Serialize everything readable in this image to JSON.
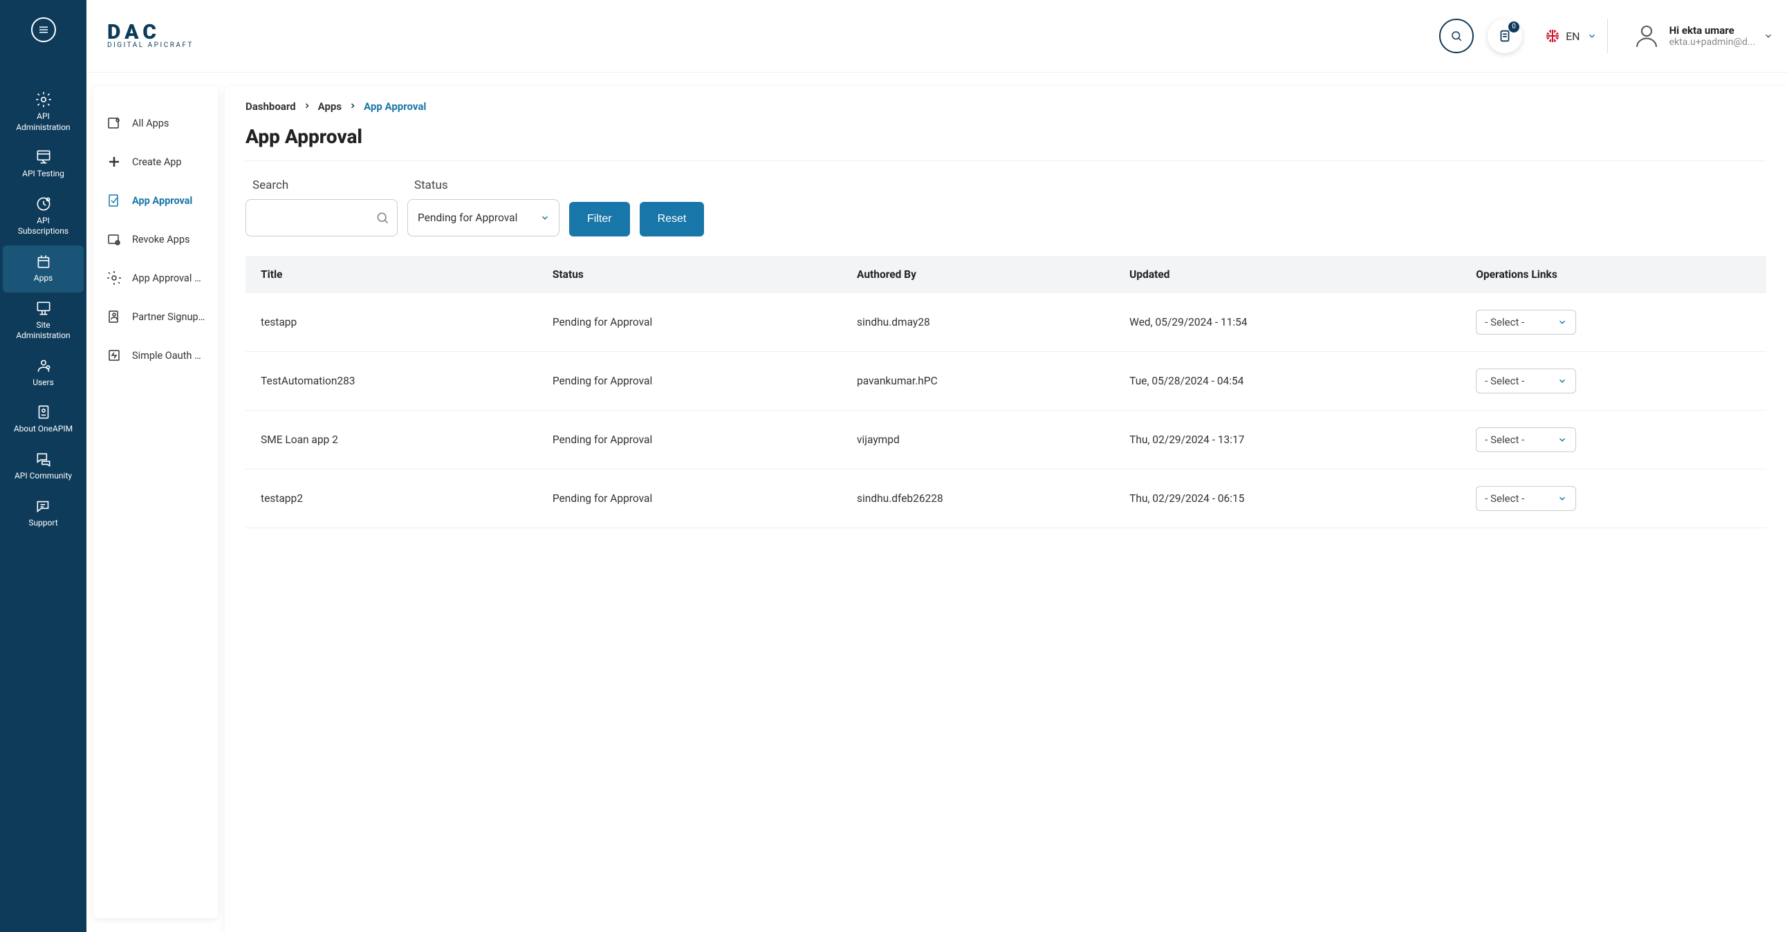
{
  "brand": {
    "name": "DAC",
    "tagline": "DIGITAL APICRAFT"
  },
  "header": {
    "badge_count": "0",
    "lang": "EN",
    "greeting": "Hi ekta umare",
    "email": "ekta.u+padmin@d..."
  },
  "nav_rail": [
    {
      "id": "api-admin",
      "label": "API\nAdministration"
    },
    {
      "id": "api-testing",
      "label": "API Testing"
    },
    {
      "id": "api-subs",
      "label": "API\nSubscriptions"
    },
    {
      "id": "apps",
      "label": "Apps",
      "active": true
    },
    {
      "id": "site-admin",
      "label": "Site\nAdministration"
    },
    {
      "id": "users",
      "label": "Users"
    },
    {
      "id": "about",
      "label": "About OneAPIM"
    },
    {
      "id": "community",
      "label": "API Community"
    },
    {
      "id": "support",
      "label": "Support"
    }
  ],
  "sub_sidebar": [
    {
      "label": "All Apps"
    },
    {
      "label": "Create App"
    },
    {
      "label": "App Approval",
      "active": true
    },
    {
      "label": "Revoke Apps"
    },
    {
      "label": "App Approval C..."
    },
    {
      "label": "Partner Signup ..."
    },
    {
      "label": "Simple Oauth C..."
    }
  ],
  "breadcrumb": [
    {
      "label": "Dashboard"
    },
    {
      "label": "Apps"
    },
    {
      "label": "App Approval",
      "current": true
    }
  ],
  "page_title": "App Approval",
  "filters": {
    "search_label": "Search",
    "status_label": "Status",
    "status_value": "Pending for Approval",
    "filter_btn": "Filter",
    "reset_btn": "Reset"
  },
  "table": {
    "headers": [
      "Title",
      "Status",
      "Authored By",
      "Updated",
      "Operations Links"
    ],
    "op_placeholder": "- Select -",
    "rows": [
      {
        "title": "testapp",
        "status": "Pending for Approval",
        "author": "sindhu.dmay28",
        "updated": "Wed, 05/29/2024 - 11:54"
      },
      {
        "title": "TestAutomation283",
        "status": "Pending for Approval",
        "author": "pavankumar.hPC",
        "updated": "Tue, 05/28/2024 - 04:54"
      },
      {
        "title": "SME Loan app 2",
        "status": "Pending for Approval",
        "author": "vijaympd",
        "updated": "Thu, 02/29/2024 - 13:17"
      },
      {
        "title": "testapp2",
        "status": "Pending for Approval",
        "author": "sindhu.dfeb26228",
        "updated": "Thu, 02/29/2024 - 06:15"
      }
    ]
  }
}
